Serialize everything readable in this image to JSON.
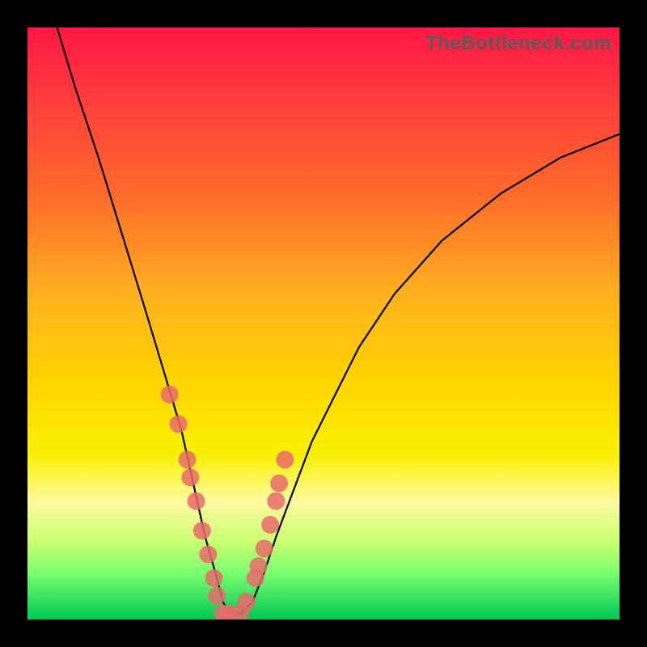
{
  "watermark": "TheBottleneck.com",
  "chart_data": {
    "type": "line",
    "title": "",
    "xlabel": "",
    "ylabel": "",
    "xlim": [
      0,
      100
    ],
    "ylim": [
      0,
      100
    ],
    "series": [
      {
        "name": "bottleneck-curve",
        "x": [
          5,
          8,
          12,
          16,
          20,
          23,
          26,
          28,
          30,
          32,
          33,
          34,
          36,
          38,
          40,
          42,
          45,
          48,
          52,
          56,
          62,
          70,
          80,
          90,
          100
        ],
        "y": [
          100,
          90,
          78,
          65,
          52,
          42,
          32,
          23,
          14,
          7,
          3,
          1,
          1,
          3,
          8,
          14,
          22,
          30,
          38,
          46,
          55,
          64,
          72,
          78,
          82
        ]
      }
    ],
    "markers": {
      "name": "highlight-points",
      "x": [
        24,
        25.5,
        27,
        27.5,
        28.5,
        29.5,
        30.5,
        31.5,
        32,
        33,
        34,
        36,
        37,
        38.5,
        39,
        40,
        41,
        42,
        42.5,
        43.5
      ],
      "y": [
        38,
        33,
        27,
        24,
        20,
        15,
        11,
        7,
        4,
        1,
        1,
        1,
        3,
        7,
        9,
        12,
        16,
        20,
        23,
        27
      ],
      "color": "#e86b6b",
      "radius": 11
    }
  }
}
